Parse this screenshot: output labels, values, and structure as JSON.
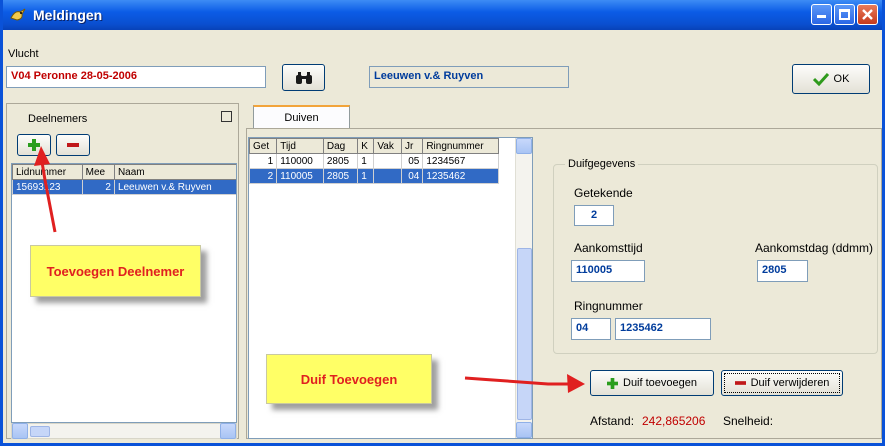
{
  "window": {
    "title": "Meldingen"
  },
  "flight": {
    "label": "Vlucht",
    "value": "V04 Peronne 28-05-2006",
    "participant_name": "Leeuwen v.& Ruyven"
  },
  "ok_button": {
    "label": "OK"
  },
  "participants": {
    "label": "Deelnemers",
    "columns": [
      "Lidnummer",
      "Mee",
      "Naam"
    ],
    "rows": [
      {
        "lidnummer": "15693123",
        "mee": "2",
        "naam": "Leeuwen v.& Ruyven"
      }
    ]
  },
  "tabs": [
    {
      "label": "Duiven"
    }
  ],
  "pigeons": {
    "columns": [
      "Get",
      "Tijd",
      "Dag",
      "K",
      "Vak",
      "Jr",
      "Ringnummer"
    ],
    "rows": [
      {
        "get": "1",
        "tijd": "110000",
        "dag": "2805",
        "k": "1",
        "vak": "",
        "jr": "05",
        "ring": "1234567"
      },
      {
        "get": "2",
        "tijd": "110005",
        "dag": "2805",
        "k": "1",
        "vak": "",
        "jr": "04",
        "ring": "1235462"
      }
    ]
  },
  "details": {
    "group_label": "Duifgegevens",
    "getekende_label": "Getekende",
    "getekende_value": "2",
    "aankomsttijd_label": "Aankomsttijd",
    "aankomsttijd_value": "110005",
    "aankomstdag_label": "Aankomstdag (ddmm)",
    "aankomstdag_value": "2805",
    "ringnummer_label": "Ringnummer",
    "ring_year": "04",
    "ring_number": "1235462"
  },
  "actions": {
    "add_pigeon": "Duif toevoegen",
    "remove_pigeon": "Duif verwijderen"
  },
  "footer": {
    "afstand_label": "Afstand:",
    "afstand_value": "242,865206",
    "snelheid_label": "Snelheid:"
  },
  "annotations": {
    "add_participant": "Toevoegen Deelnemer",
    "add_pigeon": "Duif Toevoegen"
  },
  "colors": {
    "title_bar": "#0a4fd0",
    "selection": "#316ac5",
    "flight_text": "#c00000",
    "callout_bg": "#ffff66",
    "callout_text": "#e02020",
    "arrow": "#e02020",
    "afstand_value": "#c00000"
  }
}
